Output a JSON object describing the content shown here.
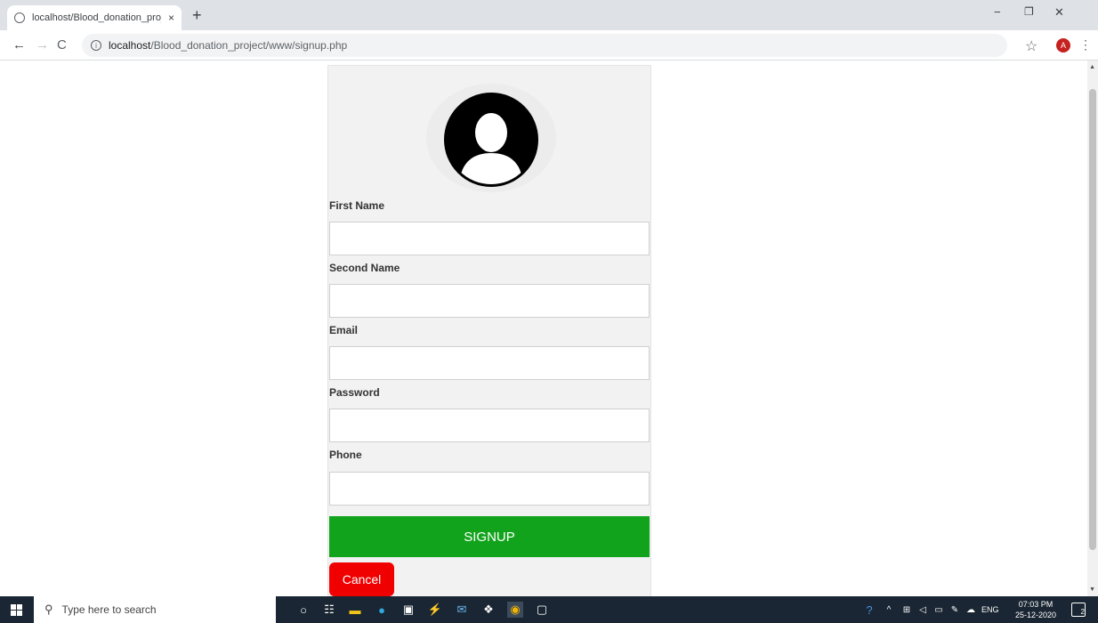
{
  "browser": {
    "tab_title": "localhost/Blood_donation_projec",
    "tab_close": "×",
    "new_tab": "+",
    "window_minimize": "−",
    "window_maximize": "❐",
    "window_close": "✕",
    "nav_back": "←",
    "nav_forward": "→",
    "nav_reload": "C",
    "url_host": "localhost",
    "url_path": "/Blood_donation_project/www/signup.php",
    "profile_initial": "A"
  },
  "form": {
    "fields": [
      {
        "label": "First Name",
        "value": ""
      },
      {
        "label": "Second Name",
        "value": ""
      },
      {
        "label": "Email",
        "value": ""
      },
      {
        "label": "Password",
        "value": ""
      },
      {
        "label": "Phone",
        "value": ""
      }
    ],
    "submit_label": "SIGNUP",
    "cancel_label": "Cancel"
  },
  "taskbar": {
    "search_placeholder": "Type here to search",
    "language": "ENG",
    "time": "07:03 PM",
    "date": "25-12-2020",
    "notification_count": "2"
  },
  "colors": {
    "signup_button": "#12a31c",
    "cancel_button": "#f00000",
    "taskbar": "#1a2633"
  }
}
